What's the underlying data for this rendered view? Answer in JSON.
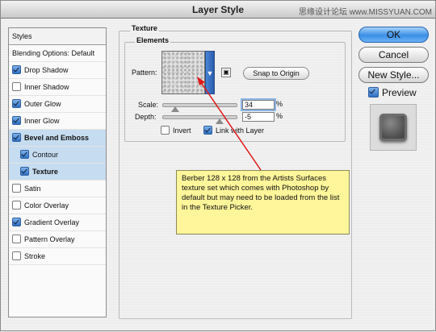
{
  "window": {
    "title": "Layer Style",
    "watermark": "思缘设计论坛 www.MISSYUAN.COM"
  },
  "sidebar": {
    "header": "Styles",
    "items": [
      {
        "label": "Blending Options: Default",
        "checkbox": false,
        "checked": false,
        "bold": false,
        "selected": false,
        "indent": false
      },
      {
        "label": "Drop Shadow",
        "checkbox": true,
        "checked": true,
        "bold": false,
        "selected": false,
        "indent": false
      },
      {
        "label": "Inner Shadow",
        "checkbox": true,
        "checked": false,
        "bold": false,
        "selected": false,
        "indent": false
      },
      {
        "label": "Outer Glow",
        "checkbox": true,
        "checked": true,
        "bold": false,
        "selected": false,
        "indent": false
      },
      {
        "label": "Inner Glow",
        "checkbox": true,
        "checked": true,
        "bold": false,
        "selected": false,
        "indent": false
      },
      {
        "label": "Bevel and Emboss",
        "checkbox": true,
        "checked": true,
        "bold": true,
        "selected": true,
        "indent": false
      },
      {
        "label": "Contour",
        "checkbox": true,
        "checked": true,
        "bold": false,
        "selected": true,
        "indent": true
      },
      {
        "label": "Texture",
        "checkbox": true,
        "checked": true,
        "bold": true,
        "selected": true,
        "indent": true
      },
      {
        "label": "Satin",
        "checkbox": true,
        "checked": false,
        "bold": false,
        "selected": false,
        "indent": false
      },
      {
        "label": "Color Overlay",
        "checkbox": true,
        "checked": false,
        "bold": false,
        "selected": false,
        "indent": false
      },
      {
        "label": "Gradient Overlay",
        "checkbox": true,
        "checked": true,
        "bold": false,
        "selected": false,
        "indent": false
      },
      {
        "label": "Pattern Overlay",
        "checkbox": true,
        "checked": false,
        "bold": false,
        "selected": false,
        "indent": false
      },
      {
        "label": "Stroke",
        "checkbox": true,
        "checked": false,
        "bold": false,
        "selected": false,
        "indent": false
      }
    ]
  },
  "texture": {
    "group_title": "Texture",
    "elements_title": "Elements",
    "pattern_label": "Pattern:",
    "snap_button": "Snap to Origin",
    "scale_label": "Scale:",
    "scale_value": "34",
    "scale_unit": "%",
    "depth_label": "Depth:",
    "depth_value": "-5",
    "depth_unit": "%",
    "invert_label": "Invert",
    "invert_checked": false,
    "link_label": "Link with Layer",
    "link_checked": true
  },
  "buttons": {
    "ok": "OK",
    "cancel": "Cancel",
    "new_style": "New Style...",
    "preview_label": "Preview",
    "preview_checked": true
  },
  "annotation": {
    "text": "Berber 128 x 128  from the Artists Surfaces texture set which comes with Photoshop by default but may need to be loaded from the list in the Texture Picker."
  },
  "colors": {
    "accent": "#3a8ee6",
    "selection": "#c6dcf0",
    "note_bg": "#fff59a",
    "arrow": "#e01818"
  }
}
